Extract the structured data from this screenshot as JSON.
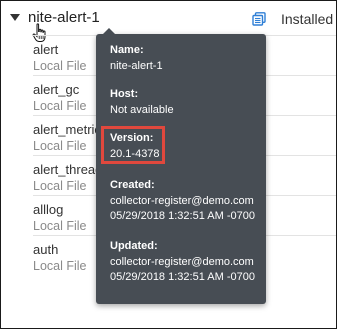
{
  "header": {
    "node_title": "nite-alert-1",
    "status": "Installed",
    "doc_icon": "document-stack-icon",
    "expand_icon": "caret-down-icon",
    "cursor_icon": "hand-pointer-icon"
  },
  "rows": [
    {
      "name": "alert",
      "type": "Local File"
    },
    {
      "name": "alert_gc",
      "type": "Local File"
    },
    {
      "name": "alert_metric",
      "type": "Local File"
    },
    {
      "name": "alert_thread",
      "type": "Local File"
    },
    {
      "name": "alllog",
      "type": "Local File"
    },
    {
      "name": "auth",
      "type": "Local File"
    }
  ],
  "tooltip": {
    "name_label": "Name:",
    "name_value": "nite-alert-1",
    "host_label": "Host:",
    "host_value": "Not available",
    "version_label": "Version:",
    "version_value": "20.1-4378",
    "created_label": "Created:",
    "created_by": "collector-register@demo.com",
    "created_at": "05/29/2018 1:32:51 AM -0700",
    "updated_label": "Updated:",
    "updated_by": "collector-register@demo.com",
    "updated_at": "05/29/2018 1:32:51 AM -0700"
  },
  "colors": {
    "tooltip_bg": "#474d54",
    "highlight": "#e0483d",
    "doc_icon": "#2f7fd6"
  }
}
